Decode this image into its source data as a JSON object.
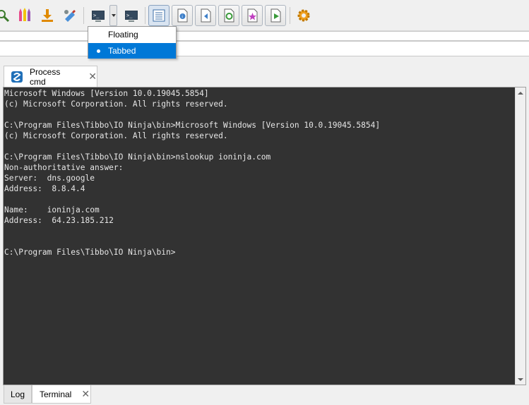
{
  "toolbar": {
    "icons": [
      "search-icon",
      "pencils-icon",
      "download-icon",
      "plugin-icon",
      "console-icon",
      "console-dropdown-icon",
      "console-tool-icon",
      "log-view-icon",
      "info-doc-icon",
      "back-doc-icon",
      "refresh-doc-icon",
      "star-doc-icon",
      "play-doc-icon",
      "gear-icon"
    ]
  },
  "menu": {
    "items": [
      {
        "label": "Floating",
        "selected": false
      },
      {
        "label": "Tabbed",
        "selected": true
      }
    ]
  },
  "doc_tab": {
    "label": "Process cmd",
    "close": "✕"
  },
  "terminal": {
    "lines": [
      "Microsoft Windows [Version 10.0.19045.5854]",
      "(c) Microsoft Corporation. All rights reserved.",
      "",
      "C:\\Program Files\\Tibbo\\IO Ninja\\bin>Microsoft Windows [Version 10.0.19045.5854]",
      "(c) Microsoft Corporation. All rights reserved.",
      "",
      "C:\\Program Files\\Tibbo\\IO Ninja\\bin>nslookup ioninja.com",
      "Non-authoritative answer:",
      "Server:  dns.google",
      "Address:  8.8.4.4",
      "",
      "Name:    ioninja.com",
      "Address:  64.23.185.212",
      "",
      "",
      "C:\\Program Files\\Tibbo\\IO Ninja\\bin>"
    ]
  },
  "bottom_tabs": [
    {
      "label": "Log",
      "active": false
    },
    {
      "label": "Terminal",
      "active": true,
      "close": "✕"
    }
  ],
  "colors": {
    "accent": "#0078d7",
    "terminal_bg": "#323232",
    "terminal_fg": "#e6e6e6"
  }
}
